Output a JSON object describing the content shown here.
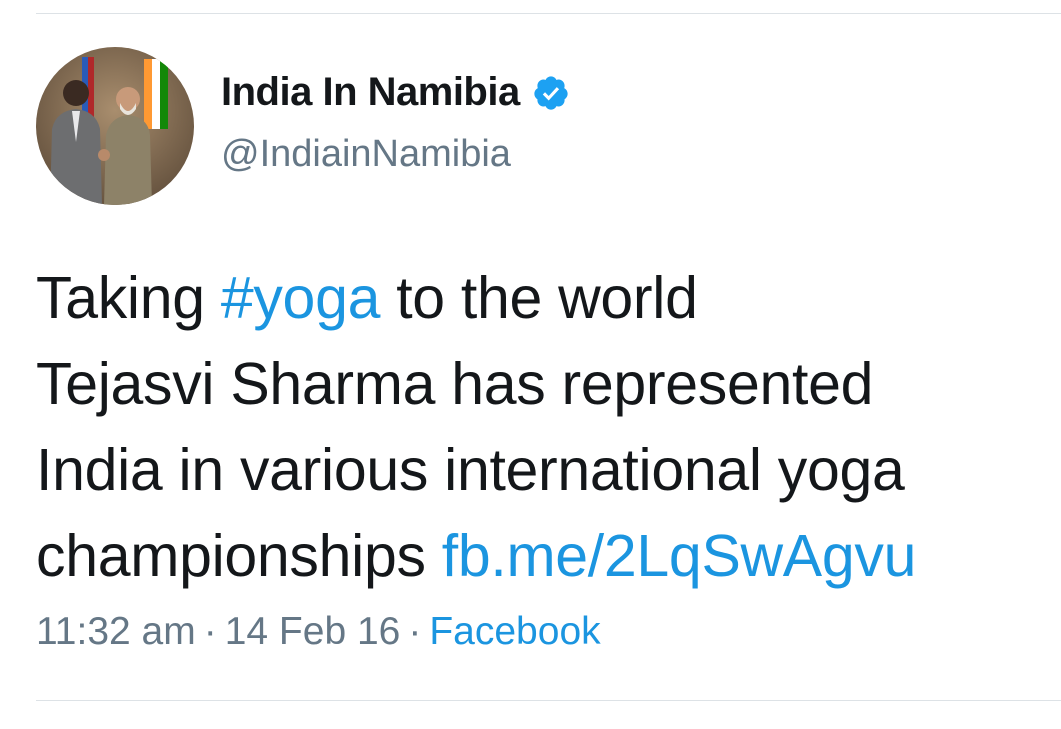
{
  "colors": {
    "text": "#14171a",
    "secondary": "#657786",
    "link": "#1b95e0",
    "verified": "#1da1f2",
    "divider": "#dde2e6"
  },
  "user": {
    "display_name": "India In Namibia",
    "handle": "@IndiainNamibia",
    "verified_icon": "verified-badge-icon"
  },
  "tweet": {
    "line1_prefix": "Taking ",
    "hashtag": "#yoga",
    "line1_suffix": " to the world",
    "line2": "Tejasvi Sharma has represented",
    "line3": "India in various international yoga",
    "line4_prefix": "championships ",
    "link_text": "fb.me/2LqSwAgvu"
  },
  "meta": {
    "time": "11:32 am",
    "separator": "·",
    "date": "14 Feb 16",
    "source": "Facebook"
  }
}
